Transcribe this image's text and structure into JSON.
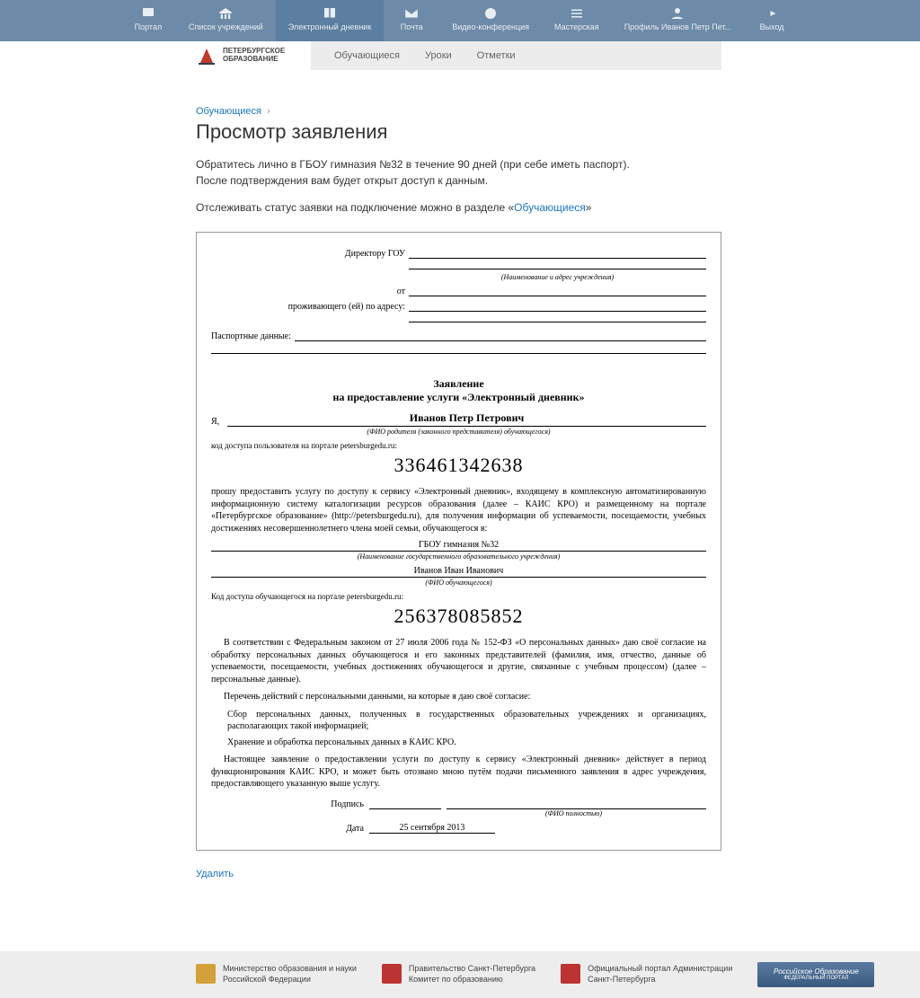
{
  "topnav": [
    {
      "label": "Портал"
    },
    {
      "label": "Список учреждений"
    },
    {
      "label": "Электронный дневник"
    },
    {
      "label": "Почта"
    },
    {
      "label": "Видео-конференция"
    },
    {
      "label": "Мастерская"
    },
    {
      "label": "Профиль Иванов Петр Пет..."
    },
    {
      "label": "Выход"
    }
  ],
  "logo": {
    "line1": "ПЕТЕРБУРГСКОЕ",
    "line2": "ОБРАЗОВАНИЕ"
  },
  "subnav": [
    {
      "label": "Обучающиеся"
    },
    {
      "label": "Уроки"
    },
    {
      "label": "Отметки"
    }
  ],
  "breadcrumb": {
    "link": "Обучающиеся"
  },
  "page_title": "Просмотр заявления",
  "desc1": "Обратитесь лично в ГБОУ гимназия №32 в течение 90 дней (при себе иметь паспорт).",
  "desc2": "После подтверждения вам будет открыт доступ к данным.",
  "desc3_pre": "Отслеживать статус заявки на подключение можно в разделе «",
  "desc3_link": "Обучающиеся",
  "desc3_post": "»",
  "doc": {
    "hdr_director": "Директору ГОУ",
    "hdr_director_sub": "(Наименование и адрес учреждения)",
    "hdr_from": "от",
    "hdr_live": "проживающего (ей) по адресу:",
    "hdr_passport": "Паспортные данные:",
    "title1": "Заявление",
    "title2": "на предоставление услуги «Электронный дневник»",
    "ya": "Я,",
    "parent_name": "Иванов Петр Петрович",
    "parent_sub": "(ФИО родителя (законного представителя) обучающегося)",
    "code1_label": "код доступа пользователя на портале petersburgedu.ru:",
    "code1": "336461342638",
    "body1": "прошу предоставить услугу по доступу к сервису «Электронный дневник», входящему в комплексную автоматизированную информационную систему каталогизации ресурсов образования (далее – КАИС КРО) и размещенному на портале «Петербургское образование» (http://petersburgedu.ru), для получения информации об успеваемости, посещаемости, учебных достижениях несовершеннолетнего члена моей семьи, обучающегося в:",
    "school": "ГБОУ гимназия №32",
    "school_sub": "(Наименование государственного образовательного учреждения)",
    "student": "Иванов Иван Иванович",
    "student_sub": "(ФИО обучающегося)",
    "code2_label": "Код доступа обучающегося на портале petersburgedu.ru:",
    "code2": "256378085852",
    "body2": "В соответствии с Федеральным законом от 27 июля 2006 года № 152-ФЗ «О персональных данных» даю своё согласие на обработку персональных данных обучающегося и его законных представителей (фамилия, имя, отчество, данные об успеваемости, посещаемости, учебных достижениях обучающегося и другие, связанные с учебным процессом) (далее – персональные данные).",
    "body3": "Перечень действий с персональными данными, на которые я даю своё согласие:",
    "body3a": "Сбор персональных данных, полученных в государственных образовательных учреждениях и организациях, располагающих такой информацией;",
    "body3b": "Хранение и обработка персональных данных в КАИС КРО.",
    "body4": "Настоящее заявление о предоставлении услуги по доступу к сервису «Электронный дневник» действует в период функционирования КАИС КРО, и может быть отозвано мною путём подачи письменного заявления в адрес учреждения, предоставляющего указанную выше услугу.",
    "sign_label": "Подпись",
    "sign_sub": "(ФИО полностью)",
    "date_label": "Дата",
    "date": "25 сентября 2013"
  },
  "delete": "Удалить",
  "footer": {
    "f1a": "Министерство образования и науки",
    "f1b": "Российской Федерации",
    "f2a": "Правительство Санкт-Петербурга",
    "f2b": "Комитет по образованию",
    "f3a": "Официальный портал Администрации",
    "f3b": "Санкт-Петербурга",
    "banner1": "Российское Образование",
    "banner2": "ФЕДЕРАЛЬНЫЙ ПОРТАЛ"
  }
}
